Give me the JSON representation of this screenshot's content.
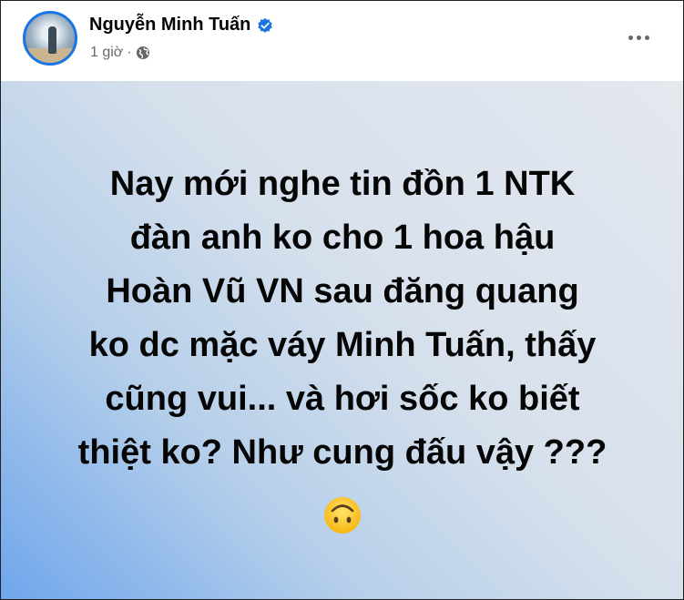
{
  "post": {
    "author": "Nguyễn Minh Tuấn",
    "verified": true,
    "time": "1 giờ",
    "separator": "·",
    "audience_icon": "globe-icon",
    "text": "Nay mới nghe tin đồn 1 NTK\nđàn anh ko cho 1 hoa hậu\nHoàn Vũ VN sau đăng quang\nko dc mặc váy Minh Tuấn, thấy\ncũng vui... và hơi sốc ko biết\nthiệt ko? Như cung đấu vậy ???",
    "emoji": "upside-down-face-emoji"
  },
  "colors": {
    "verified_badge": "#1b74e4",
    "meta_text": "#65676b",
    "background_gradient": [
      "#6fa6ec",
      "#d6e0ec",
      "#e4e8ef"
    ]
  }
}
